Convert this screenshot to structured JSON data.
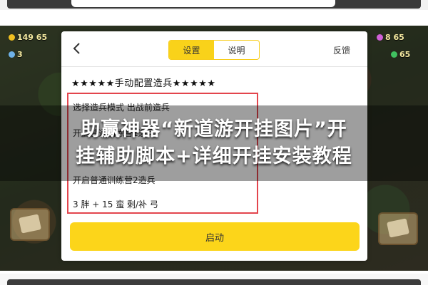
{
  "hud": {
    "gold_value": "149 65",
    "level_value": "3",
    "elixir_value": "8 65",
    "gem_value": "65"
  },
  "panel": {
    "tabs": [
      {
        "label": "设置",
        "active": true
      },
      {
        "label": "说明",
        "active": false
      }
    ],
    "feedback_label": "反馈",
    "config_title": "★★★★★手动配置造兵★★★★★",
    "rows": [
      "选择造兵模式  出战前造兵",
      "开启普通训练营1造兵",
      "开启普通训练营2造兵",
      "3  胖    + 15  蛮      剩/补  弓"
    ],
    "start_label": "启动"
  },
  "banner": {
    "line1": "助赢神器“新道游开挂图片”开",
    "line2": "挂辅助脚本+详细开挂安装教程"
  },
  "colors": {
    "accent_yellow": "#f9d21a",
    "highlight_red": "#e3454d"
  }
}
